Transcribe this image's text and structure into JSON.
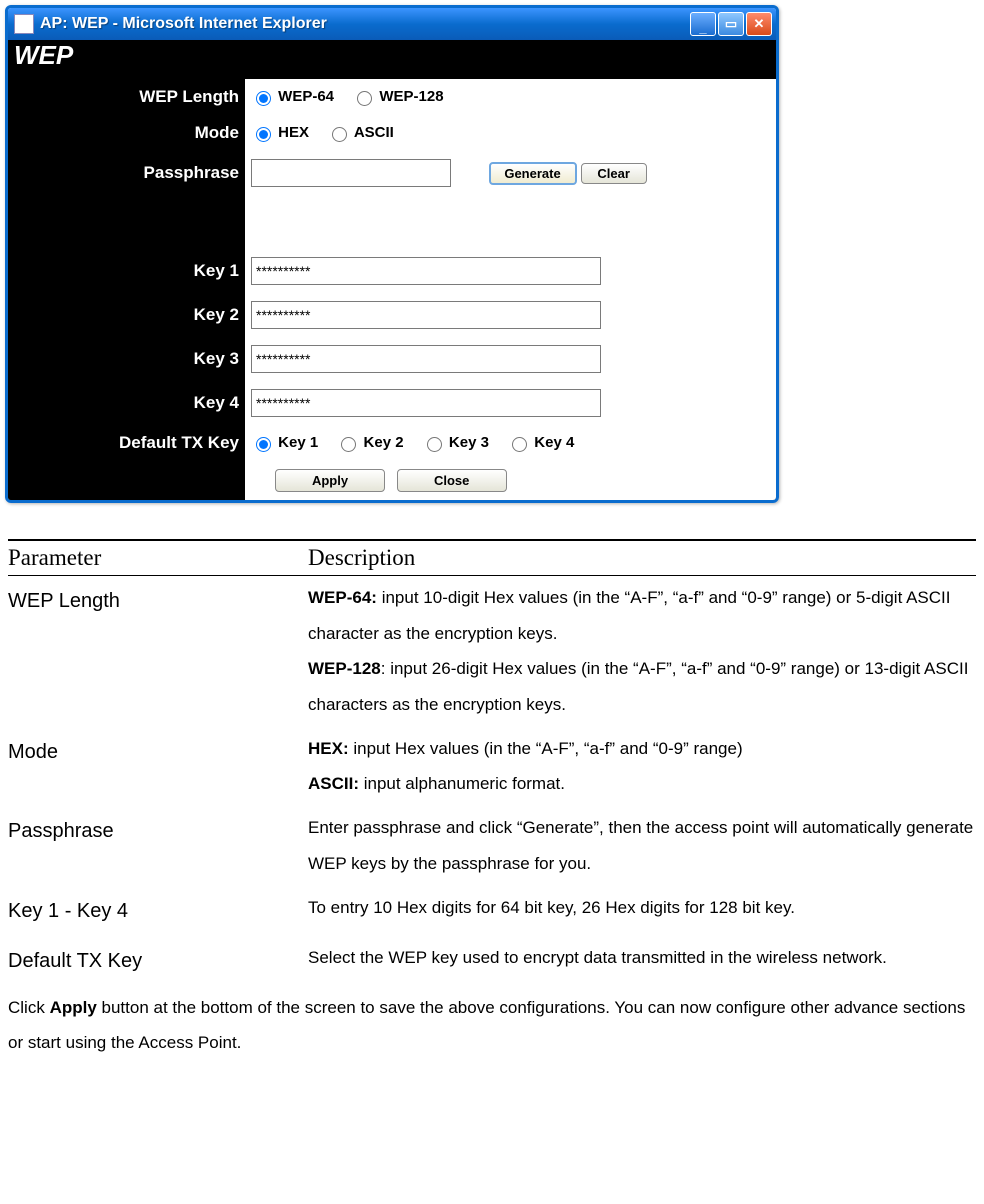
{
  "window": {
    "title": "AP: WEP - Microsoft Internet Explorer"
  },
  "page_heading": "WEP",
  "labels": {
    "wep_length": "WEP Length",
    "mode": "Mode",
    "passphrase": "Passphrase",
    "key1": "Key 1",
    "key2": "Key 2",
    "key3": "Key 3",
    "key4": "Key 4",
    "default_tx": "Default TX Key"
  },
  "options": {
    "wep64": "WEP-64",
    "wep128": "WEP-128",
    "hex": "HEX",
    "ascii": "ASCII",
    "k1": "Key 1",
    "k2": "Key 2",
    "k3": "Key 3",
    "k4": "Key 4"
  },
  "buttons": {
    "generate": "Generate",
    "clear": "Clear",
    "apply": "Apply",
    "close": "Close"
  },
  "values": {
    "passphrase": "",
    "key1": "**********",
    "key2": "**********",
    "key3": "**********",
    "key4": "**********"
  },
  "desc": {
    "header_param": "Parameter",
    "header_desc": "Description",
    "rows": {
      "wep_length_param": "WEP Length",
      "wep_length_desc_b1": "WEP-64:",
      "wep_length_desc_t1": " input 10-digit Hex values (in the “A-F”, “a-f” and “0-9” range) or 5-digit ASCII character as the encryption keys.",
      "wep_length_desc_b2": "WEP-128",
      "wep_length_desc_t2": ": input 26-digit Hex values (in the “A-F”, “a-f” and “0-9” range) or 13-digit ASCII characters as the encryption keys.",
      "mode_param": "Mode",
      "mode_desc_b1": "HEX:",
      "mode_desc_t1": " input Hex values (in the “A-F”, “a-f” and “0-9” range)",
      "mode_desc_b2": "ASCII:",
      "mode_desc_t2": " input alphanumeric format.",
      "pass_param": "Passphrase",
      "pass_desc": "Enter passphrase and click “Generate”, then the access point will automatically generate WEP keys by the passphrase for you.",
      "keys_param": "Key 1 - Key 4",
      "keys_desc": "To entry 10 Hex digits for 64 bit key, 26 Hex digits for 128 bit key.",
      "tx_param": "Default TX Key",
      "tx_desc": "Select the WEP key used to encrypt data transmitted in the wireless network."
    },
    "footnote_pre": "Click ",
    "footnote_b": "Apply",
    "footnote_post": " button at the bottom of the screen to save the above configurations. You can now configure other advance sections or start using the Access Point."
  }
}
